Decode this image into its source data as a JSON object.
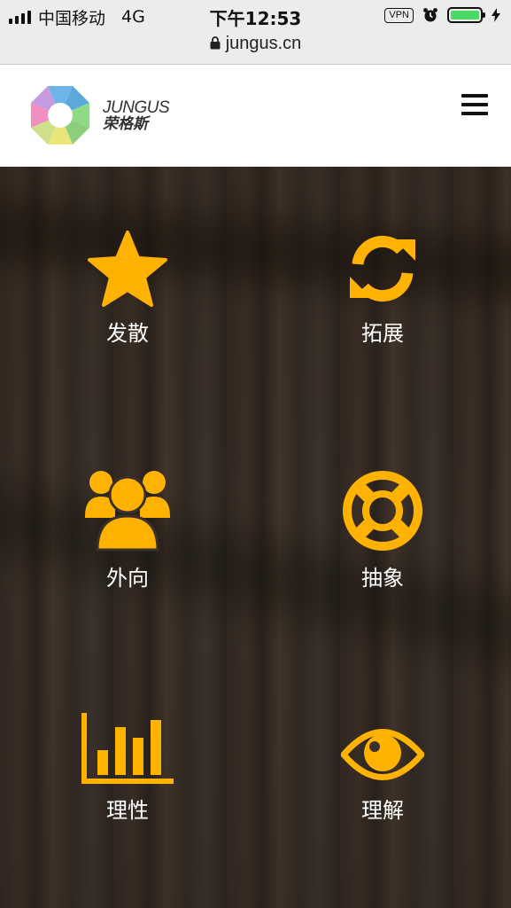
{
  "status_bar": {
    "carrier": "中国移动",
    "network": "4G",
    "time": "下午12:53",
    "vpn": "VPN"
  },
  "browser": {
    "url": "jungus.cn"
  },
  "header": {
    "logo_en": "JUNGUS",
    "logo_cn": "荣格斯"
  },
  "features": [
    {
      "label": "发散",
      "icon": "star-icon"
    },
    {
      "label": "拓展",
      "icon": "refresh-icon"
    },
    {
      "label": "外向",
      "icon": "users-icon"
    },
    {
      "label": "抽象",
      "icon": "life-ring-icon"
    },
    {
      "label": "理性",
      "icon": "bar-chart-icon"
    },
    {
      "label": "理解",
      "icon": "eye-icon"
    }
  ],
  "colors": {
    "accent": "#FFB300",
    "status_battery": "#4CD964"
  }
}
